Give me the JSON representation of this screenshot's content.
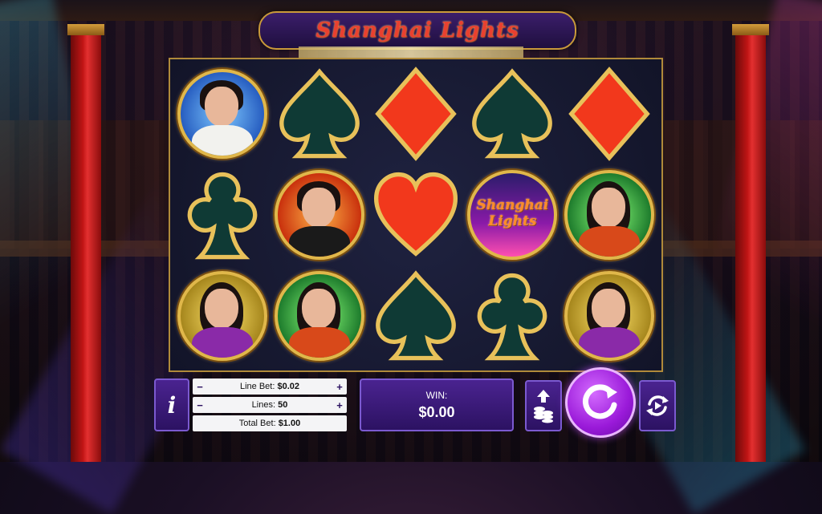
{
  "game": {
    "title": "Shanghai Lights",
    "logo_text_line1": "Shanghai",
    "logo_text_line2": "Lights"
  },
  "reels": [
    [
      "man-white-suit",
      "spade",
      "diamond",
      "spade",
      "diamond"
    ],
    [
      "club",
      "man-tuxedo",
      "heart",
      "logo",
      "woman-champagne"
    ],
    [
      "woman-cocktail",
      "woman-champagne",
      "spade",
      "club",
      "woman-cocktail"
    ]
  ],
  "controls": {
    "info_label": "i",
    "line_bet_label": "Line Bet:",
    "line_bet_value": "$0.02",
    "lines_label": "Lines:",
    "lines_value": "50",
    "total_bet_label": "Total Bet:",
    "total_bet_value": "$1.00",
    "minus": "−",
    "plus": "+",
    "win_label": "WIN:",
    "win_value": "$0.00"
  },
  "colors": {
    "accent_purple": "#4a2390",
    "spin_purple": "#9a1ad9",
    "title_red": "#e94030",
    "gold": "#e0b74a"
  },
  "icons": {
    "info": "info-icon",
    "bet_max": "coin-stack-icon",
    "spin": "spin-arrow-icon",
    "autoplay": "autoplay-icon"
  }
}
